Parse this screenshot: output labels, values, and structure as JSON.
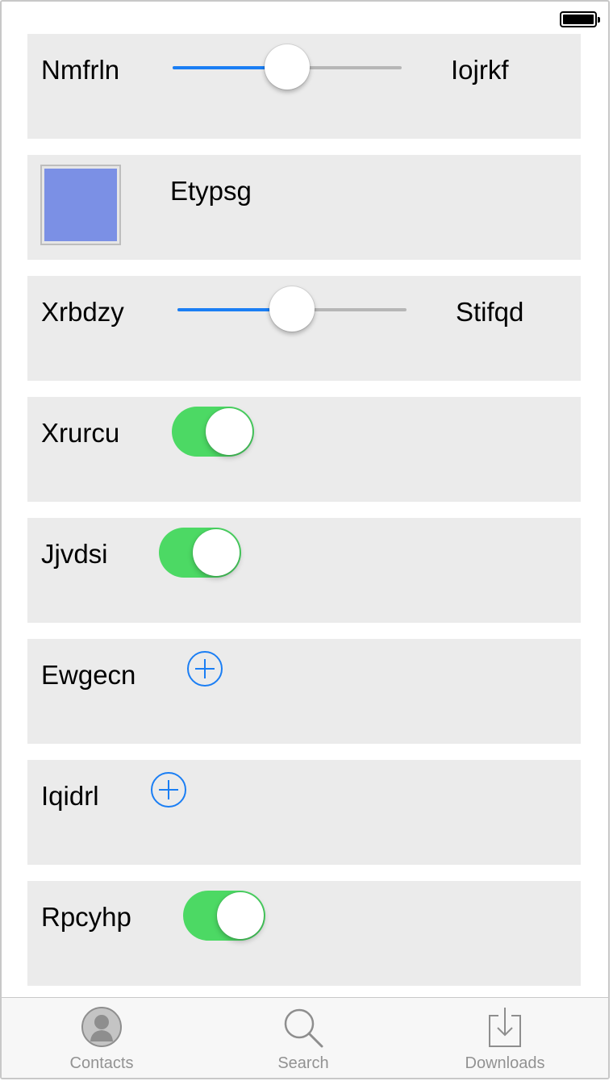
{
  "colors": {
    "accent": "#1a7ef4",
    "toggle_on": "#4cd964",
    "row_bg": "#ebebeb",
    "swatch": "#7b90e5",
    "tab_inactive": "#929292"
  },
  "rows": [
    {
      "type": "slider",
      "label": "Nmfrln",
      "value_label": "Iojrkf",
      "value": 0.5
    },
    {
      "type": "color",
      "color": "#7b90e5",
      "label": "Etypsg"
    },
    {
      "type": "slider",
      "label": "Xrbdzy",
      "value_label": "Stifqd",
      "value": 0.5
    },
    {
      "type": "toggle",
      "label": "Xrurcu",
      "on": true
    },
    {
      "type": "toggle",
      "label": "Jjvdsi",
      "on": true
    },
    {
      "type": "add",
      "label": "Ewgecn",
      "icon": "plus-circle-icon"
    },
    {
      "type": "add",
      "label": "Iqidrl",
      "icon": "plus-circle-icon"
    },
    {
      "type": "toggle",
      "label": "Rpcyhp",
      "on": true
    }
  ],
  "tabbar": {
    "tabs": [
      {
        "label": "Contacts",
        "icon": "contact-person-icon"
      },
      {
        "label": "Search",
        "icon": "magnifier-icon"
      },
      {
        "label": "Downloads",
        "icon": "download-tray-icon"
      }
    ]
  }
}
